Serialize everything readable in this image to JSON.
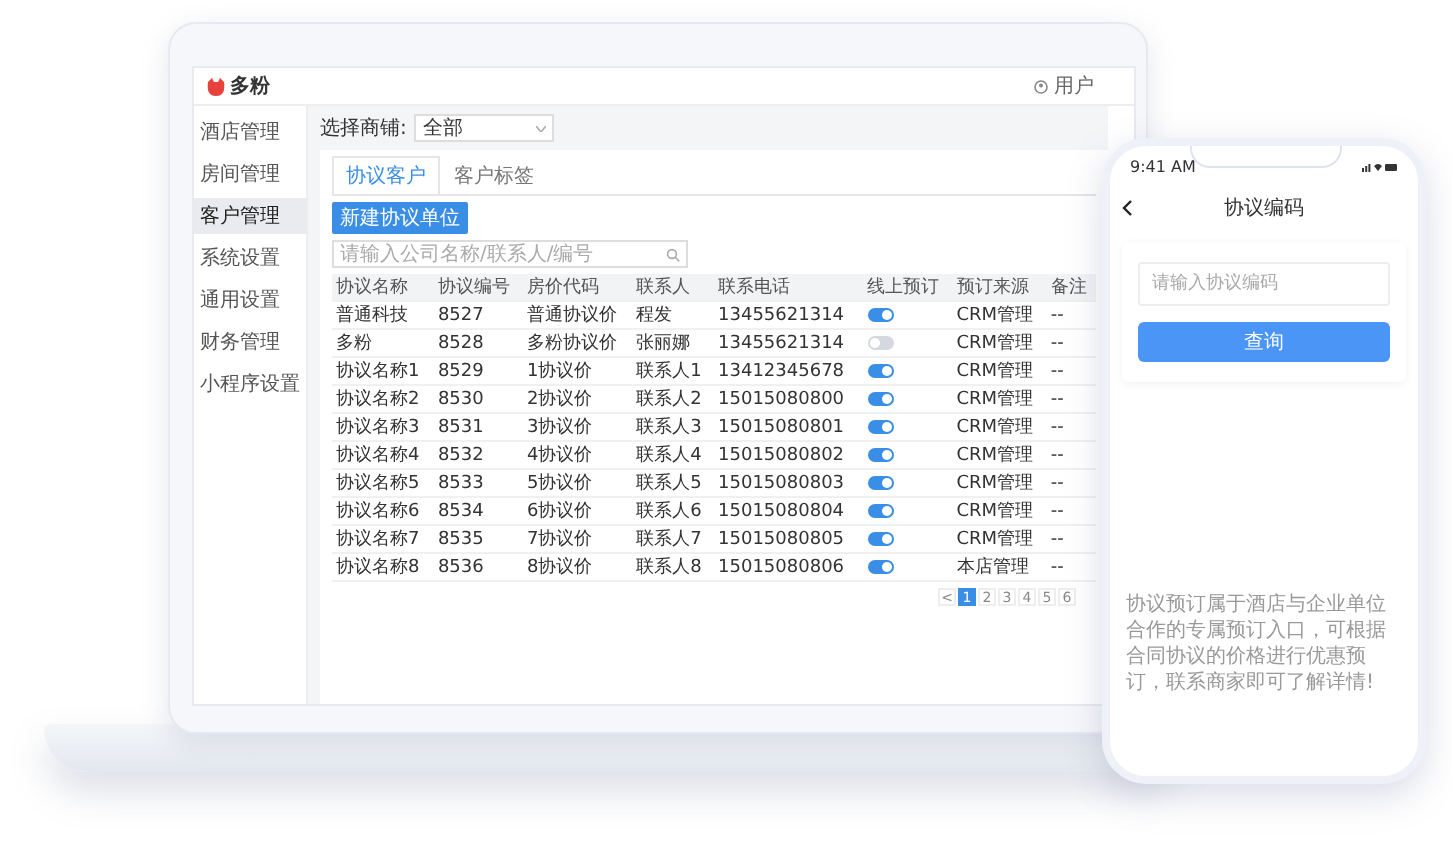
{
  "laptop": {
    "logo": "多粉",
    "user": "用户",
    "sidebar": {
      "items": [
        {
          "label": "酒店管理",
          "selected": false
        },
        {
          "label": "房间管理",
          "selected": false
        },
        {
          "label": "客户管理",
          "selected": true
        },
        {
          "label": "系统设置",
          "selected": false
        },
        {
          "label": "通用设置",
          "selected": false
        },
        {
          "label": "财务管理",
          "selected": false
        },
        {
          "label": "小程序设置",
          "selected": false
        }
      ]
    },
    "filter": {
      "label": "选择商铺:",
      "value": "全部"
    },
    "tabs": [
      {
        "label": "协议客户",
        "selected": true
      },
      {
        "label": "客户标签",
        "selected": false
      }
    ],
    "new_button": "新建协议单位",
    "search": {
      "placeholder": "请输入公司名称/联系人/编号"
    },
    "table": {
      "columns": [
        "协议名称",
        "协议编号",
        "房价代码",
        "联系人",
        "联系电话",
        "线上预订",
        "预订来源",
        "备注"
      ],
      "rows": [
        {
          "name": "普通科技",
          "code": "8527",
          "rate": "普通协议价",
          "contact": "程发",
          "phone": "13455621314",
          "online": true,
          "source": "CRM管理",
          "note": "--"
        },
        {
          "name": "多粉",
          "code": "8528",
          "rate": "多粉协议价",
          "contact": "张丽娜",
          "phone": "13455621314",
          "online": false,
          "source": "CRM管理",
          "note": "--"
        },
        {
          "name": "协议名称1",
          "code": "8529",
          "rate": "1协议价",
          "contact": "联系人1",
          "phone": "13412345678",
          "online": true,
          "source": "CRM管理",
          "note": "--"
        },
        {
          "name": "协议名称2",
          "code": "8530",
          "rate": "2协议价",
          "contact": "联系人2",
          "phone": "15015080800",
          "online": true,
          "source": "CRM管理",
          "note": "--"
        },
        {
          "name": "协议名称3",
          "code": "8531",
          "rate": "3协议价",
          "contact": "联系人3",
          "phone": "15015080801",
          "online": true,
          "source": "CRM管理",
          "note": "--"
        },
        {
          "name": "协议名称4",
          "code": "8532",
          "rate": "4协议价",
          "contact": "联系人4",
          "phone": "15015080802",
          "online": true,
          "source": "CRM管理",
          "note": "--"
        },
        {
          "name": "协议名称5",
          "code": "8533",
          "rate": "5协议价",
          "contact": "联系人5",
          "phone": "15015080803",
          "online": true,
          "source": "CRM管理",
          "note": "--"
        },
        {
          "name": "协议名称6",
          "code": "8534",
          "rate": "6协议价",
          "contact": "联系人6",
          "phone": "15015080804",
          "online": true,
          "source": "CRM管理",
          "note": "--"
        },
        {
          "name": "协议名称7",
          "code": "8535",
          "rate": "7协议价",
          "contact": "联系人7",
          "phone": "15015080805",
          "online": true,
          "source": "CRM管理",
          "note": "--"
        },
        {
          "name": "协议名称8",
          "code": "8536",
          "rate": "8协议价",
          "contact": "联系人8",
          "phone": "15015080806",
          "online": true,
          "source": "本店管理",
          "note": "--"
        }
      ]
    },
    "pagination": {
      "prev": "<",
      "pages": [
        {
          "label": "1",
          "selected": true
        },
        {
          "label": "2",
          "selected": false
        },
        {
          "label": "3",
          "selected": false
        },
        {
          "label": "4",
          "selected": false
        },
        {
          "label": "5",
          "selected": false
        },
        {
          "label": "6",
          "selected": false
        }
      ]
    }
  },
  "phone": {
    "time": "9:41 AM",
    "title": "协议编码",
    "input": {
      "placeholder": "请输入协议编码"
    },
    "button": "查询",
    "note": "协议预订属于酒店与企业单位合作的专属预订入口，可根据合同协议的价格进行优惠预订，联系商家即可了解详情!"
  }
}
